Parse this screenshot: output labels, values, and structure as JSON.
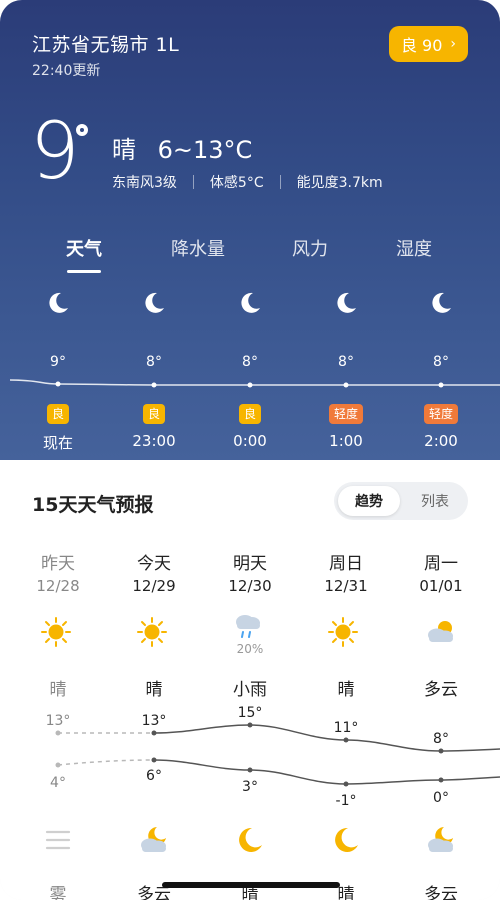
{
  "location": {
    "city": "江苏省无锡市 1L",
    "updated": "22:40更新"
  },
  "aqi_button": {
    "label": "良 90",
    "chevron": "›"
  },
  "current": {
    "temp": "9",
    "condition": "晴",
    "range": "6~13°C",
    "wind": "东南风3级",
    "feels": "体感5°C",
    "visibility": "能见度3.7km"
  },
  "tabs": [
    "天气",
    "降水量",
    "风力",
    "湿度"
  ],
  "hourly": [
    {
      "temp": "9°",
      "aqi": "良",
      "time": "现在",
      "icon": "moon-icon",
      "aqi_color": "#f7b500"
    },
    {
      "temp": "8°",
      "aqi": "良",
      "time": "23:00",
      "icon": "moon-icon",
      "aqi_color": "#f7b500"
    },
    {
      "temp": "8°",
      "aqi": "良",
      "time": "0:00",
      "icon": "moon-icon",
      "aqi_color": "#f7b500"
    },
    {
      "temp": "8°",
      "aqi": "轻度",
      "time": "1:00",
      "icon": "moon-icon",
      "aqi_color": "#f07a3a"
    },
    {
      "temp": "8°",
      "aqi": "轻度",
      "time": "2:00",
      "icon": "moon-icon",
      "aqi_color": "#f07a3a"
    }
  ],
  "forecast": {
    "title": "15天天气预报",
    "toggle": {
      "trend": "趋势",
      "list": "列表"
    },
    "days": [
      {
        "name": "昨天",
        "date": "12/28",
        "day_icon": "sun-icon",
        "precip": "",
        "day_cond": "晴",
        "high": "13°",
        "low": "4°",
        "night_icon": "menu-lines-icon",
        "night_cond": "雾",
        "past": true
      },
      {
        "name": "今天",
        "date": "12/29",
        "day_icon": "sun-icon",
        "precip": "",
        "day_cond": "晴",
        "high": "13°",
        "low": "6°",
        "night_icon": "cloudy-night-icon",
        "night_cond": "多云",
        "past": false
      },
      {
        "name": "明天",
        "date": "12/30",
        "day_icon": "light-rain-icon",
        "precip": "20%",
        "day_cond": "小雨",
        "high": "15°",
        "low": "3°",
        "night_icon": "moon-icon",
        "night_cond": "晴",
        "past": false
      },
      {
        "name": "周日",
        "date": "12/31",
        "day_icon": "sun-icon",
        "precip": "",
        "day_cond": "晴",
        "high": "11°",
        "low": "-1°",
        "night_icon": "moon-icon",
        "night_cond": "晴",
        "past": false
      },
      {
        "name": "周一",
        "date": "01/01",
        "day_icon": "partly-cloudy-icon",
        "precip": "",
        "day_cond": "多云",
        "high": "8°",
        "low": "0°",
        "night_icon": "cloudy-night-icon",
        "night_cond": "多云",
        "past": false
      }
    ]
  },
  "colors": {
    "hero_top": "#2b3c78",
    "hero_bottom": "#45629b",
    "aqi_good": "#f7b500",
    "aqi_light": "#f07a3a",
    "sun": "#f7b500"
  }
}
